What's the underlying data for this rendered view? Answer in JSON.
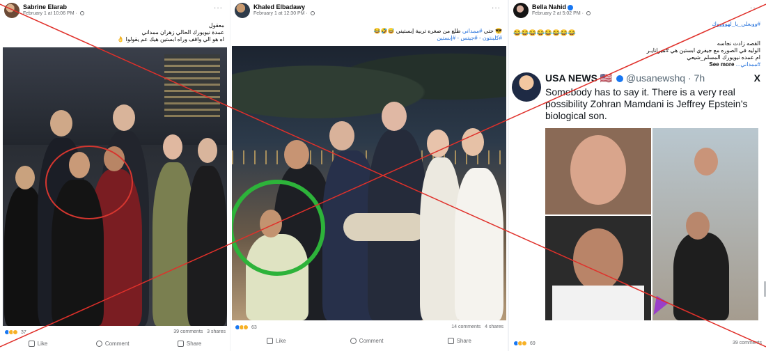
{
  "posts": [
    {
      "author": "Sabrine Elarab",
      "timestamp": "February 1 at 10:06 PM",
      "caption": [
        "معقول",
        "عمدة نيويورك الحالي زهران ممداني",
        "اه هو الي واقف وراه ابستين هيك عم يقولوا"
      ],
      "reaction_count": "37",
      "comments": "39 comments",
      "shares": "3 shares",
      "like_label": "Like",
      "comment_label": "Comment",
      "share_label": "Share"
    },
    {
      "author": "Khaled Elbadawy",
      "timestamp": "February 1 at 12:30 PM",
      "caption_line1_prefix": "حتي ",
      "caption_line1_tag": "#ممداني",
      "caption_line1_suffix": " طلع من صغره تربية إبستيني",
      "caption_line2": "#كلينتون - #جيتس - #إبستين",
      "reaction_count": "63",
      "comments": "14 comments",
      "shares": "4 shares",
      "like_label": "Like",
      "comment_label": "Comment",
      "share_label": "Share"
    },
    {
      "author": "Bella Nahid",
      "timestamp": "February 2 at 5:02 PM",
      "hashtag_top": "#ووبعلي_يا_لهووووك",
      "caption": [
        "القصه زادت نجاسه",
        "الوليه في الصوره مع جيفري ابستين هي #ميرانايـر",
        "ام عمده نيويورك المسلم_شيعي"
      ],
      "see_more": "See more",
      "caption_tail": "#ممداني...",
      "reaction_count": "69",
      "comments": "39 comments",
      "tweet": {
        "name": "USA NEWS",
        "handle": "@usanewshq · 7h",
        "text": "Somebody has to say it. There is a very real possibility Zohran Mamdani is Jeffrey Epstein’s biological son.",
        "x_logo": "X"
      }
    }
  ],
  "colors": {
    "cross": "#e0302a",
    "circle_red": "#d6362f",
    "circle_green": "#2db33a",
    "link": "#216fdb",
    "muted": "#65676b"
  }
}
